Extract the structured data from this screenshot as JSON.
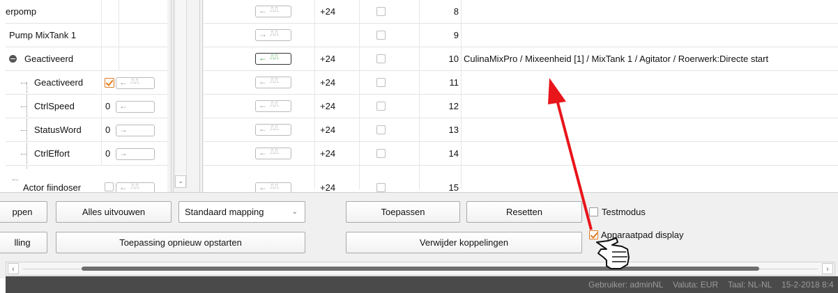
{
  "tree_rows": [
    {
      "name": "erpomp",
      "value": "",
      "has_io": false,
      "checked": false
    },
    {
      "name": "Pump MixTank 1",
      "value": "",
      "has_io": false,
      "checked": false
    },
    {
      "name": "Geactiveerd",
      "value": "",
      "has_io": false,
      "checked": false
    },
    {
      "name": "Geactiveerd",
      "value": "",
      "has_io": true,
      "checked": true
    },
    {
      "name": "CtrlSpeed",
      "value": "0",
      "has_io": true,
      "checked": false
    },
    {
      "name": "StatusWord",
      "value": "0",
      "has_io": true,
      "checked": false
    },
    {
      "name": "CtrlEffort",
      "value": "0",
      "has_io": true,
      "checked": false
    },
    {
      "name": "Actor fiindoser",
      "value": "",
      "has_io": true,
      "checked": false
    }
  ],
  "grid_rows": [
    {
      "voltage": "+24",
      "number": "8",
      "path": "",
      "active": false
    },
    {
      "voltage": "",
      "number": "9",
      "path": "",
      "active": false
    },
    {
      "voltage": "+24",
      "number": "10",
      "path": "CulinaMixPro / Mixeenheid [1] / MixTank 1 / Agitator / Roerwerk:Directe start",
      "active": true
    },
    {
      "voltage": "+24",
      "number": "11",
      "path": "",
      "active": false
    },
    {
      "voltage": "+24",
      "number": "12",
      "path": "",
      "active": false
    },
    {
      "voltage": "+24",
      "number": "13",
      "path": "",
      "active": false
    },
    {
      "voltage": "+24",
      "number": "14",
      "path": "",
      "active": false
    },
    {
      "voltage": "+24",
      "number": "15",
      "path": "",
      "active": false
    }
  ],
  "panel": {
    "btn_collapse_partial": "ppen",
    "btn_expand_all": "Alles uitvouwen",
    "mapping_select": "Standaard mapping",
    "btn_apply": "Toepassen",
    "btn_reset": "Resetten",
    "test_mode_label": "Testmodus",
    "test_mode_checked": false,
    "btn_partial_2": "lling",
    "btn_restart": "Toepassing opnieuw opstarten",
    "btn_remove_links": "Verwijder koppelingen",
    "device_path_label": "Apparaatpad display",
    "device_path_checked": true
  },
  "status": {
    "user": "Gebruiker: adminNL",
    "currency": "Valuta: EUR",
    "language": "Taal: NL-NL",
    "datetime": "15-2-2018  8:4"
  },
  "colors": {
    "accent_orange": "#e07a1f",
    "active_green": "#2e9a2e",
    "annotation_red": "#e8151b",
    "status_bg": "#4a4a4a"
  },
  "icons": {
    "io_toggle": "arrow-pulse-icon",
    "pointer": "hand-pointer-icon"
  }
}
